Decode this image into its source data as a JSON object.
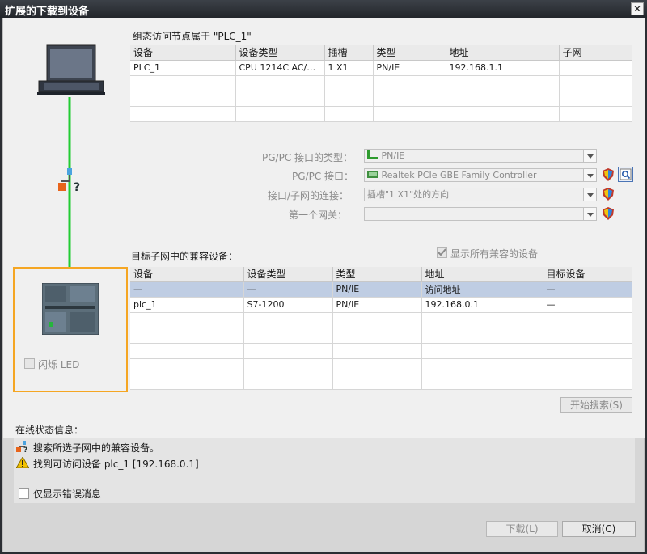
{
  "window": {
    "title": "扩展的下载到设备",
    "close_glyph": "✕"
  },
  "target": {
    "title": "组态访问节点属于 \"PLC_1\"",
    "headers": [
      "设备",
      "设备类型",
      "插槽",
      "类型",
      "地址",
      "子网"
    ],
    "rows": [
      [
        "PLC_1",
        "CPU 1214C AC/D...",
        "1 X1",
        "PN/IE",
        "192.168.1.1",
        ""
      ]
    ]
  },
  "interface": {
    "type_label": "PG/PC 接口的类型：",
    "type_value": "PN/IE",
    "iface_label": "PG/PC 接口：",
    "iface_value": "Realtek PCIe GBE Family Controller",
    "conn_label": "接口/子网的连接：",
    "conn_value": "插槽\"1 X1\"处的方向",
    "gateway_label": "第一个网关：",
    "gateway_value": ""
  },
  "compatible": {
    "title": "目标子网中的兼容设备：",
    "show_all_label": "显示所有兼容的设备",
    "show_all_checked": true,
    "headers": [
      "设备",
      "设备类型",
      "类型",
      "地址",
      "目标设备"
    ],
    "rows": [
      [
        "—",
        "—",
        "PN/IE",
        "访问地址",
        "—"
      ],
      [
        "plc_1",
        "S7-1200",
        "PN/IE",
        "192.168.0.1",
        "—"
      ]
    ]
  },
  "flash_led_label": "闪烁 LED",
  "search_button": "开始搜索(S)",
  "status": {
    "title": "在线状态信息：",
    "messages": [
      {
        "icon": "network-search-icon",
        "text": "搜索所选子网中的兼容设备。"
      },
      {
        "icon": "warning-icon",
        "text": "找到可访问设备 plc_1 [192.168.0.1]"
      }
    ]
  },
  "only_errors_label": "仅显示错误消息",
  "buttons": {
    "download": "下载(L)",
    "cancel": "取消(C)"
  },
  "colors": {
    "accent_orange": "#f5a623",
    "link_green": "#22cc33",
    "selection": "#bfcde3"
  }
}
